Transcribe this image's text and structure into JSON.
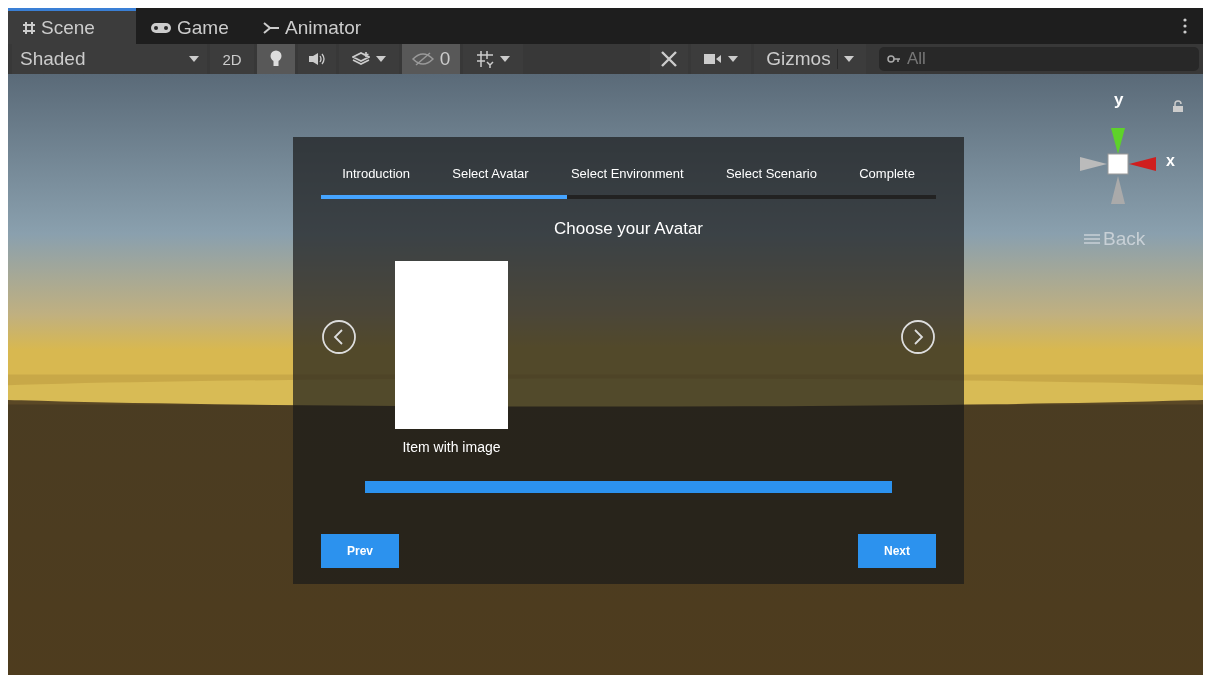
{
  "tabs": [
    {
      "label": "Scene",
      "selected": true
    },
    {
      "label": "Game",
      "selected": false
    },
    {
      "label": "Animator",
      "selected": false
    }
  ],
  "toolbar": {
    "shading": "Shaded",
    "mode_2d": {
      "label": "2D",
      "selected": false
    },
    "lighting_on": true,
    "hidden_count": {
      "label": "0",
      "selected": true
    },
    "gizmos": "Gizmos",
    "search": {
      "placeholder": "All"
    }
  },
  "gizmo": {
    "y_label": "y",
    "x_label": "x",
    "projection": "Back"
  },
  "wizard": {
    "steps": [
      {
        "label": "Introduction"
      },
      {
        "label": "Select Avatar"
      },
      {
        "label": "Select Environment"
      },
      {
        "label": "Select Scenario"
      },
      {
        "label": "Complete"
      }
    ],
    "progress": {
      "level": 0.4
    },
    "heading": "Choose your Avatar",
    "items": [
      {
        "caption": "Item with image"
      }
    ],
    "buttons": {
      "prev": "Prev",
      "next": "Next"
    }
  }
}
